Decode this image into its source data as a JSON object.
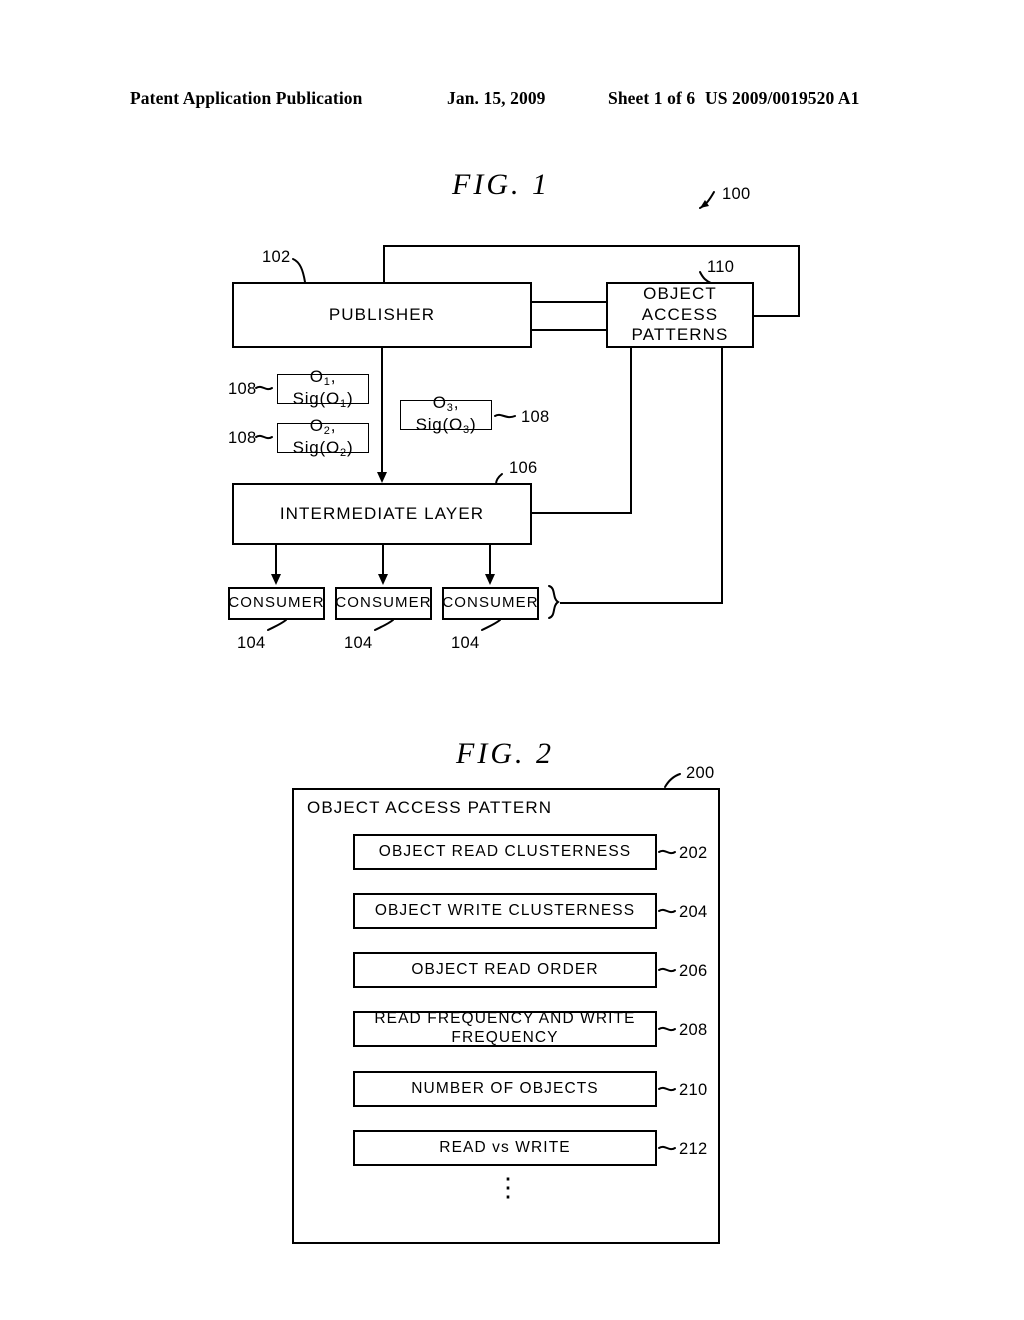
{
  "header": {
    "publication": "Patent Application Publication",
    "date": "Jan. 15, 2009",
    "sheet": "Sheet 1 of 6",
    "patent_number": "US 2009/0019520 A1"
  },
  "fig1": {
    "title": "FIG. 1",
    "ref_system": "100",
    "publisher": {
      "label": "PUBLISHER",
      "ref": "102"
    },
    "object_access_patterns": {
      "label": "OBJECT ACCESS\nPATTERNS",
      "line1": "OBJECT ACCESS",
      "line2": "PATTERNS",
      "ref": "110"
    },
    "intermediate_layer": {
      "label": "INTERMEDIATE LAYER",
      "ref": "106"
    },
    "objects": [
      {
        "id": "o1",
        "text": "O1, Sig(O1)",
        "base": "O",
        "sub": "1",
        "ref": "108",
        "ref_side": "left"
      },
      {
        "id": "o2",
        "text": "O2, Sig(O2)",
        "base": "O",
        "sub": "2",
        "ref": "108",
        "ref_side": "left"
      },
      {
        "id": "o3",
        "text": "O3, Sig(O3)",
        "base": "O",
        "sub": "3",
        "ref": "108",
        "ref_side": "right"
      }
    ],
    "consumers": [
      {
        "label": "CONSUMER",
        "ref": "104"
      },
      {
        "label": "CONSUMER",
        "ref": "104"
      },
      {
        "label": "CONSUMER",
        "ref": "104"
      }
    ]
  },
  "fig2": {
    "title": "FIG. 2",
    "ref_container": "200",
    "container_label": "OBJECT ACCESS PATTERN",
    "items": [
      {
        "label": "OBJECT READ CLUSTERNESS",
        "ref": "202"
      },
      {
        "label": "OBJECT WRITE CLUSTERNESS",
        "ref": "204"
      },
      {
        "label": "OBJECT READ ORDER",
        "ref": "206"
      },
      {
        "label": "READ FREQUENCY AND WRITE FREQUENCY",
        "ref": "208"
      },
      {
        "label": "NUMBER OF OBJECTS",
        "ref": "210"
      },
      {
        "label": "READ vs WRITE",
        "ref": "212"
      }
    ],
    "continuation_marker": "⋮"
  },
  "colors": {
    "ink": "#000000",
    "paper": "#ffffff"
  }
}
